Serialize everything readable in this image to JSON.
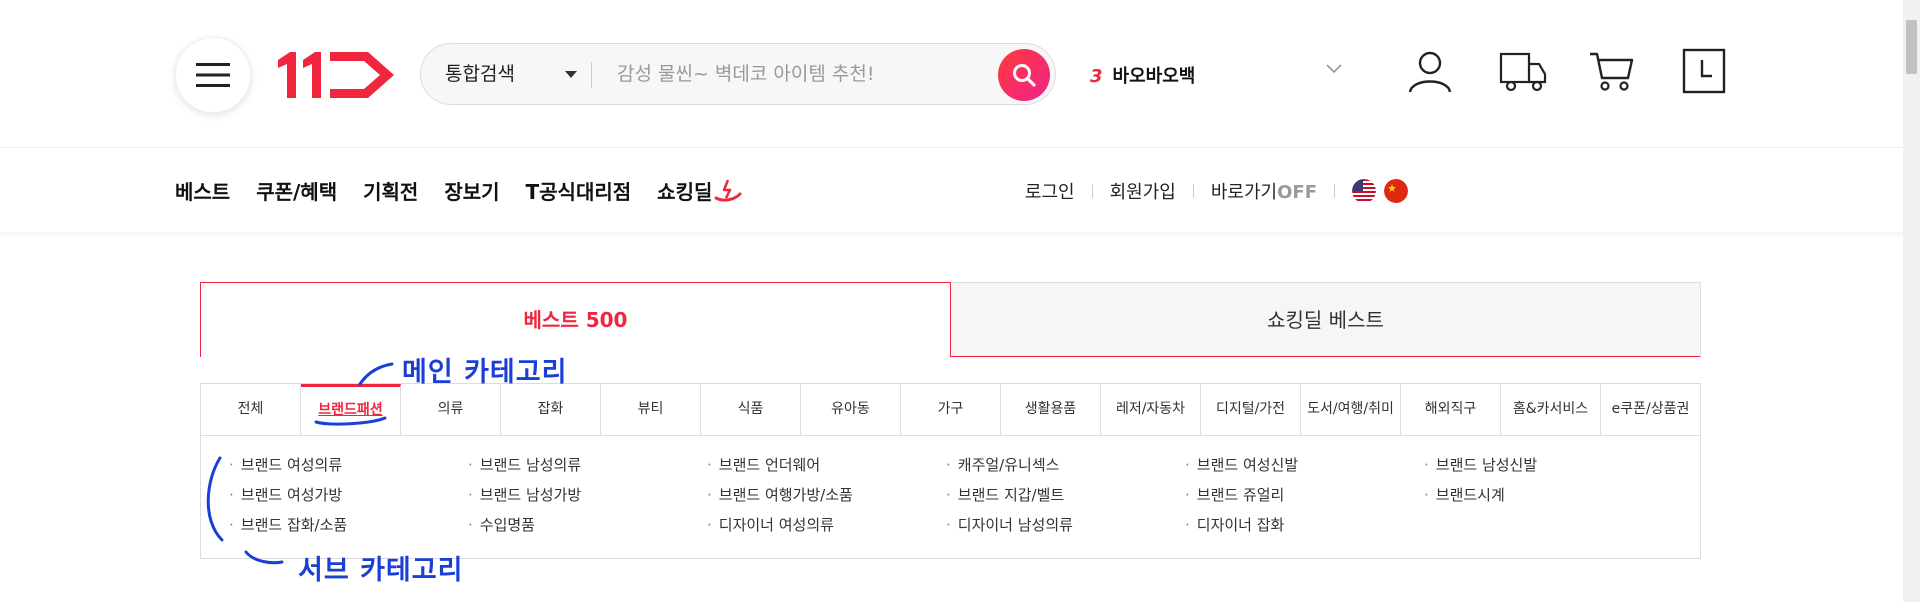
{
  "header": {
    "menu_icon": "hamburger-icon",
    "logo_text": "11",
    "search": {
      "type_label": "통합검색",
      "placeholder": "감성 물씬~ 벽데코 아이템 추천!"
    },
    "ticker": {
      "rank": "3",
      "keyword": "바오바오백"
    },
    "icons": [
      "user-icon",
      "delivery-truck-icon",
      "cart-icon",
      "recent-viewed-icon"
    ]
  },
  "nav": {
    "left": [
      "베스트",
      "쿠폰/혜택",
      "기획전",
      "장보기",
      "T공식대리점"
    ],
    "shocking_deal": "쇼킹딜",
    "right": {
      "login": "로그인",
      "signup": "회원가입",
      "shortcut": "바로가기",
      "shortcut_state": "OFF"
    }
  },
  "tabs": {
    "best": "베스트 500",
    "shocking_best": "쇼킹딜 베스트"
  },
  "categories": [
    "전체",
    "브랜드패션",
    "의류",
    "잡화",
    "뷰티",
    "식품",
    "유아동",
    "가구",
    "생활용품",
    "레저/자동차",
    "디지털/가전",
    "도서/여행/취미",
    "해외직구",
    "홈&카서비스",
    "e쿠폰/상품권"
  ],
  "active_category": "브랜드패션",
  "subcategories": [
    "브랜드 여성의류",
    "브랜드 남성의류",
    "브랜드 언더웨어",
    "캐주얼/유니섹스",
    "브랜드 여성신발",
    "브랜드 남성신발",
    "브랜드 여성가방",
    "브랜드 남성가방",
    "브랜드 여행가방/소품",
    "브랜드 지갑/벨트",
    "브랜드 쥬얼리",
    "브랜드시계",
    "브랜드 잡화/소품",
    "수입명품",
    "디자이너 여성의류",
    "디자이너 남성의류",
    "디자이너 잡화"
  ],
  "annotations": {
    "main": "메인 카테고리",
    "sub": "서브 카테고리"
  },
  "colors": {
    "accent": "#f0263f",
    "annotation": "#1a3fd6"
  }
}
